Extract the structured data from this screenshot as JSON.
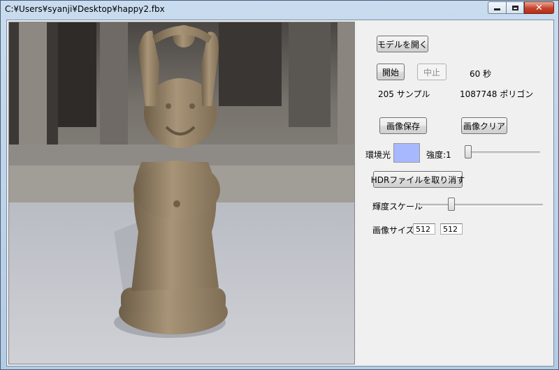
{
  "window": {
    "title": "C:¥Users¥syanji¥Desktop¥happy2.fbx"
  },
  "icons": {
    "minimize": "minimize-icon",
    "maximize": "maximize-icon",
    "close": "close-icon",
    "close_glyph": "✕"
  },
  "controls": {
    "open_model_label": "モデルを開く",
    "start_label": "開始",
    "stop_label": "中止",
    "seconds": "60 秒",
    "samples": "205 サンプル",
    "polygons": "1087748 ポリゴン",
    "save_image_label": "画像保存",
    "clear_image_label": "画像クリア",
    "ambient_label": "環境光",
    "ambient_color": "#a8b8ff",
    "intensity_label": "強度:1",
    "intensity_level": 0.0,
    "remove_hdr_label": "HDRファイルを取り消す",
    "brightness_label": "輝度スケール",
    "brightness_level": 0.25,
    "image_size_label": "画像サイズ",
    "image_width": "512",
    "image_height": "512"
  },
  "render": {
    "subject": "statue render on HDR background"
  }
}
